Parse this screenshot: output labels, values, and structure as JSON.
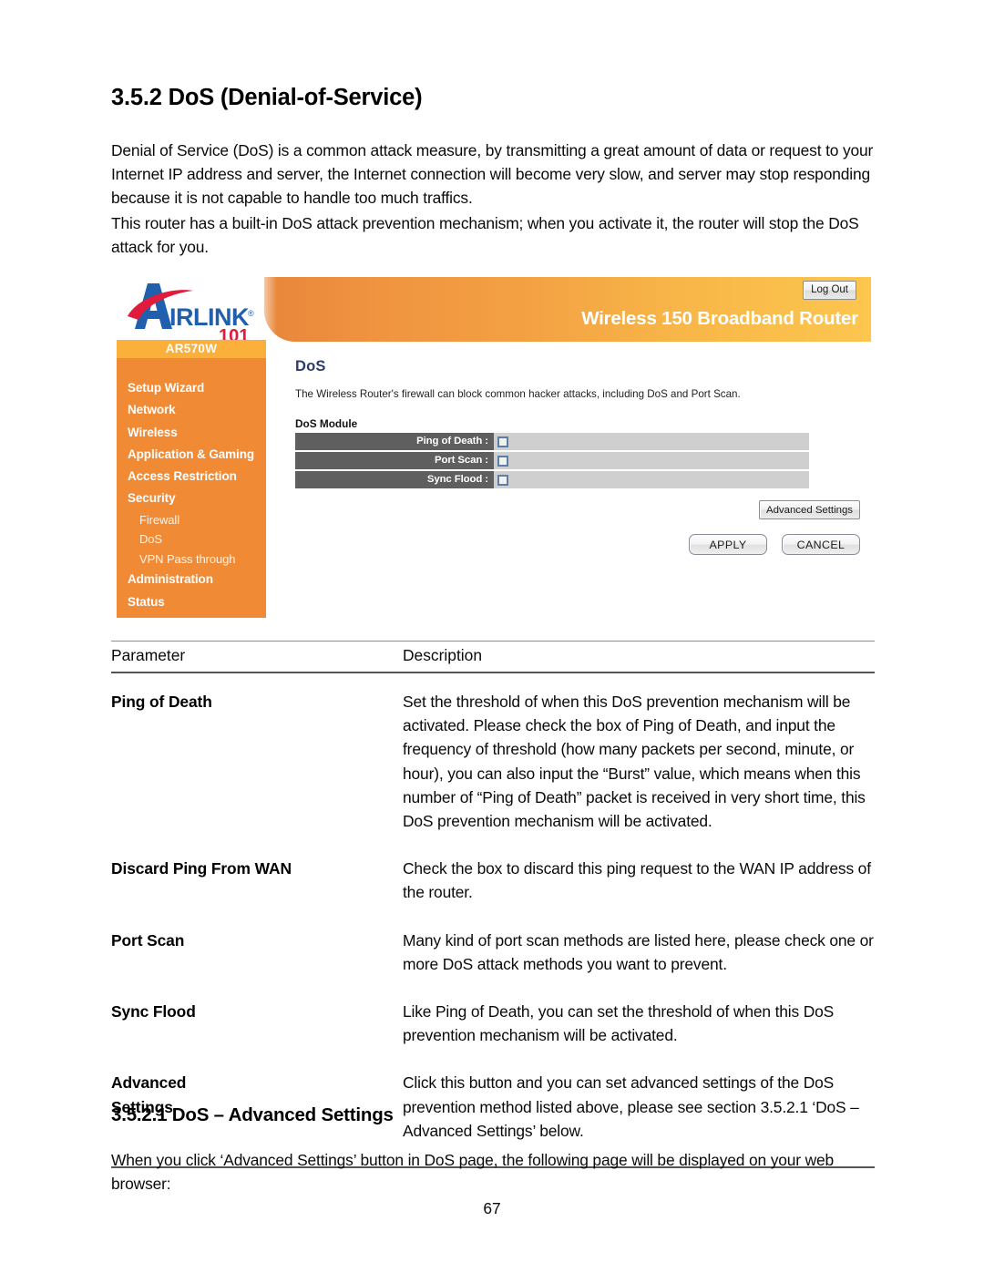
{
  "document": {
    "title": "3.5.2 DoS (Denial-of-Service)",
    "paragraph_1": "Denial of Service (DoS) is a common attack measure, by transmitting a great amount of data or request to your Internet IP address and server, the Internet connection will become very slow, and server may stop responding because it is not capable to handle too much traffics.",
    "paragraph_2": "This router has a built-in DoS attack prevention mechanism; when you activate it, the router will stop the DoS attack for you.",
    "subsection_title": "3.5.2.1 DoS – Advanced Settings",
    "paragraph_3": "When you click ‘Advanced Settings’ button in DoS page, the following page will be displayed on your web browser:",
    "page_number": "67"
  },
  "router_ui": {
    "logo": {
      "brand_air": "A",
      "brand_text": "IRLINK",
      "brand_registered": "®",
      "brand_number": "101"
    },
    "header": {
      "title": "Wireless 150 Broadband Router",
      "logout_label": "Log Out"
    },
    "sidebar": {
      "model": "AR570W",
      "items": [
        {
          "label": "Setup Wizard",
          "sub": false
        },
        {
          "label": "Network",
          "sub": false
        },
        {
          "label": "Wireless",
          "sub": false
        },
        {
          "label": "Application & Gaming",
          "sub": false
        },
        {
          "label": "Access Restriction",
          "sub": false
        },
        {
          "label": "Security",
          "sub": false
        },
        {
          "label": "Firewall",
          "sub": true
        },
        {
          "label": "DoS",
          "sub": true
        },
        {
          "label": "VPN Pass through",
          "sub": true
        },
        {
          "label": "Administration",
          "sub": false
        },
        {
          "label": "Status",
          "sub": false
        }
      ]
    },
    "panel": {
      "title": "DoS",
      "description": "The Wireless Router's firewall can block common hacker attacks, including DoS and Port Scan.",
      "module_label": "DoS Module",
      "rows": [
        {
          "label": "Ping of Death :",
          "checked": false
        },
        {
          "label": "Port Scan :",
          "checked": false
        },
        {
          "label": "Sync Flood :",
          "checked": false
        }
      ],
      "advanced_button": "Advanced Settings",
      "apply_button": "APPLY",
      "cancel_button": "CANCEL"
    },
    "colors": {
      "sidebar_bg": "#f08a35",
      "model_bg": "#fbb03b",
      "header_gradient_start": "#e8853a",
      "header_gradient_end": "#fcc64f",
      "panel_title": "#2e3b6b",
      "row_label_bg": "#5f5f5f",
      "row_value_bg": "#cfcfcf",
      "logo_blue": "#1f5fae",
      "logo_red": "#e01b3c"
    }
  },
  "param_table": {
    "header": {
      "parameter": "Parameter",
      "description": "Description"
    },
    "rows": [
      {
        "parameter": "Ping of Death",
        "parameter_line2": "",
        "description": "Set the threshold of when this DoS prevention mechanism will be activated. Please check the box of Ping of Death, and input the frequency of threshold (how many packets per second, minute, or hour), you can also input the “Burst” value, which means when this number of “Ping of Death” packet is received in very short time, this DoS prevention mechanism will be activated."
      },
      {
        "parameter": "Discard Ping From WAN",
        "parameter_line2": "",
        "description": "Check the box to discard this ping request to the WAN IP address of the router."
      },
      {
        "parameter": "Port Scan",
        "parameter_line2": "",
        "description": "Many kind of port scan methods are listed here, please check one or more DoS attack methods you want to prevent."
      },
      {
        "parameter": "Sync Flood",
        "parameter_line2": "",
        "description": "Like Ping of Death, you can set the threshold of when this DoS prevention mechanism will be activated."
      },
      {
        "parameter": "Advanced",
        "parameter_line2": "Settings",
        "description": "Click this button and you can set advanced settings of the DoS prevention method listed above, please see section 3.5.2.1 ‘DoS – Advanced Settings’ below."
      }
    ]
  }
}
